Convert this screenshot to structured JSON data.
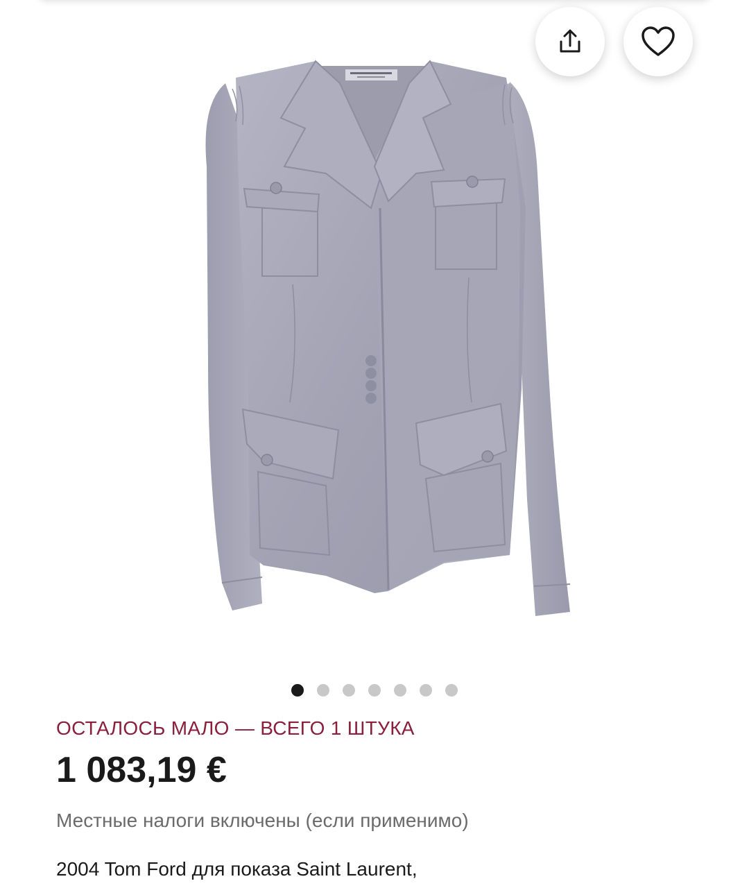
{
  "gallery": {
    "image_alt": "Серый пиджак Yves Saint Laurent",
    "label_brand": "YvesSaintLaurent",
    "slide_count": 7,
    "active_slide": 1,
    "actions": {
      "share_icon": "share-icon",
      "favorite_icon": "heart-icon"
    }
  },
  "product": {
    "stock_notice": "ОСТАЛОСЬ МАЛО — ВСЕГО 1 ШТУКА",
    "price": "1 083,19 €",
    "tax_note": "Местные налоги включены (если применимо)",
    "description": "2004 Tom Ford для показа Saint Laurent,"
  },
  "colors": {
    "stock_accent": "#8a1f3c",
    "price_text": "#1a1a1a",
    "muted_text": "#6b6b6b",
    "dot_active": "#1a1a1a",
    "dot_inactive": "#c8c8c8",
    "jacket_fabric": "#a7a7b8"
  }
}
